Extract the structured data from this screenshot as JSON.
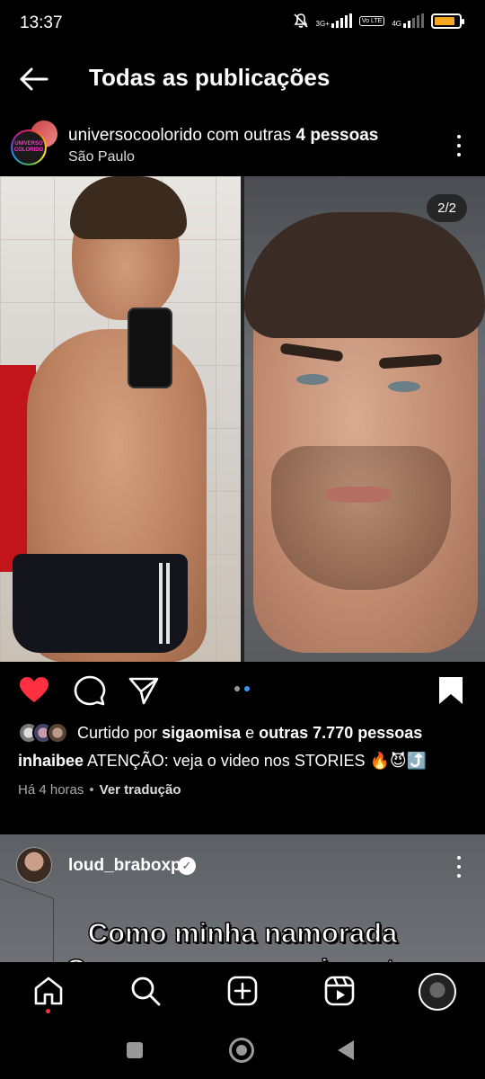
{
  "status_bar": {
    "time": "13:37",
    "net1": "3G+",
    "net2": "4G",
    "volte": "Vo LTE",
    "battery_level": 0.85,
    "battery_color": "#f5a623"
  },
  "header": {
    "title": "Todas as publicações",
    "back_icon": "arrow-left-icon"
  },
  "post": {
    "username": "universocoolorido",
    "with_text": "com outras",
    "others": "4 pessoas",
    "location": "São Paulo",
    "avatar_text": "UNIVERSO COLORIDO",
    "counter": "2/2",
    "liked": true,
    "like_color": "#ff3040",
    "likes_prefix": "Curtido por",
    "likes_user": "sigaomisa",
    "likes_mid": "e",
    "likes_rest": "outras 7.770 pessoas",
    "caption_user": "inhaibee",
    "caption_text": "ATENÇÃO: veja o video nos STORIES 🔥😈⤴️",
    "time_ago": "Há 4 horas",
    "separator": "•",
    "translate": "Ver tradução",
    "carousel_active_index": 1
  },
  "next_post": {
    "username": "loud_braboxp",
    "verified": true,
    "overlay_line1": "Como minha namorada",
    "overlay_line2": "Quer que eu cumprimente:"
  },
  "bottom_nav": {
    "items": [
      "home-icon",
      "search-icon",
      "create-icon",
      "reels-icon",
      "profile-avatar"
    ]
  },
  "system_nav": [
    "recents-icon",
    "home-icon",
    "back-icon"
  ]
}
